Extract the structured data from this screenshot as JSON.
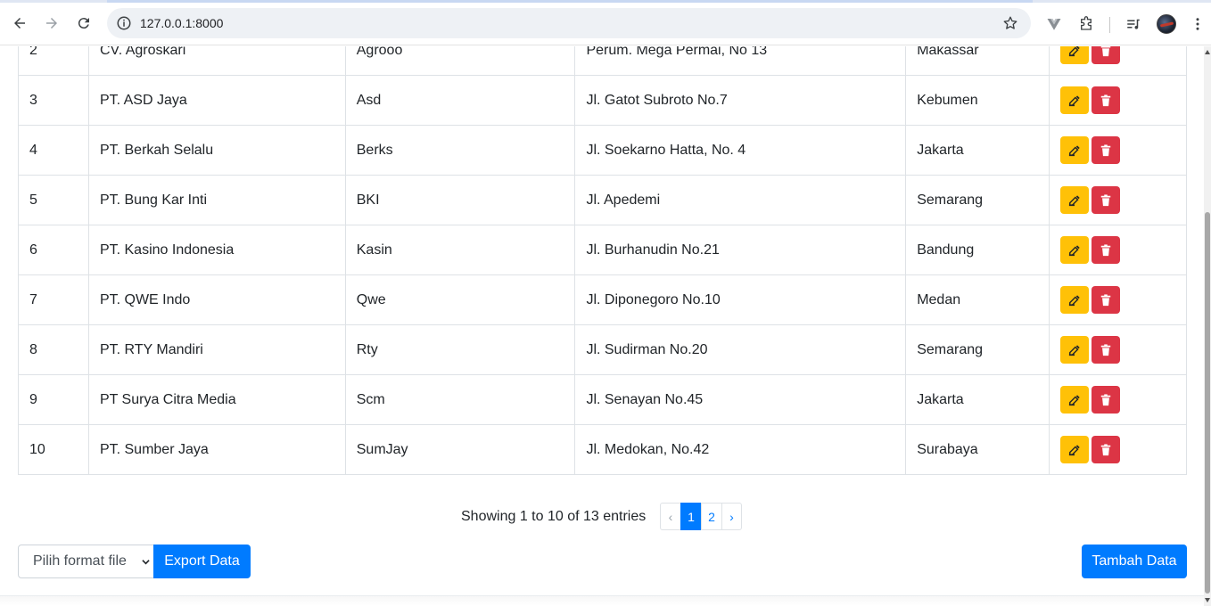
{
  "browser": {
    "url": "127.0.0.1:8000"
  },
  "table": {
    "rows": [
      {
        "no": "2",
        "nama": "CV. Agroskari",
        "alias": "Agrooo",
        "alamat": "Perum. Mega Permai, No 13",
        "kota": "Makassar"
      },
      {
        "no": "3",
        "nama": "PT. ASD Jaya",
        "alias": "Asd",
        "alamat": "Jl. Gatot Subroto No.7",
        "kota": "Kebumen"
      },
      {
        "no": "4",
        "nama": "PT. Berkah Selalu",
        "alias": "Berks",
        "alamat": "Jl. Soekarno Hatta, No. 4",
        "kota": "Jakarta"
      },
      {
        "no": "5",
        "nama": "PT. Bung Kar Inti",
        "alias": "BKI",
        "alamat": "Jl. Apedemi",
        "kota": "Semarang"
      },
      {
        "no": "6",
        "nama": "PT. Kasino Indonesia",
        "alias": "Kasin",
        "alamat": "Jl. Burhanudin No.21",
        "kota": "Bandung"
      },
      {
        "no": "7",
        "nama": "PT. QWE Indo",
        "alias": "Qwe",
        "alamat": "Jl. Diponegoro No.10",
        "kota": "Medan"
      },
      {
        "no": "8",
        "nama": "PT. RTY Mandiri",
        "alias": "Rty",
        "alamat": "Jl. Sudirman No.20",
        "kota": "Semarang"
      },
      {
        "no": "9",
        "nama": "PT Surya Citra Media",
        "alias": "Scm",
        "alamat": "Jl. Senayan No.45",
        "kota": "Jakarta"
      },
      {
        "no": "10",
        "nama": "PT. Sumber Jaya",
        "alias": "SumJay",
        "alamat": "Jl. Medokan, No.42",
        "kota": "Surabaya"
      }
    ]
  },
  "pagination": {
    "info": "Showing 1 to 10 of 13 entries",
    "prev": "‹",
    "pages": [
      "1",
      "2"
    ],
    "current": "1",
    "next": "›"
  },
  "footer": {
    "format_select": "Pilih format file",
    "export_label": "Export Data",
    "add_label": "Tambah Data"
  },
  "colors": {
    "primary": "#007bff",
    "edit": "#ffc107",
    "delete": "#dc3545"
  }
}
